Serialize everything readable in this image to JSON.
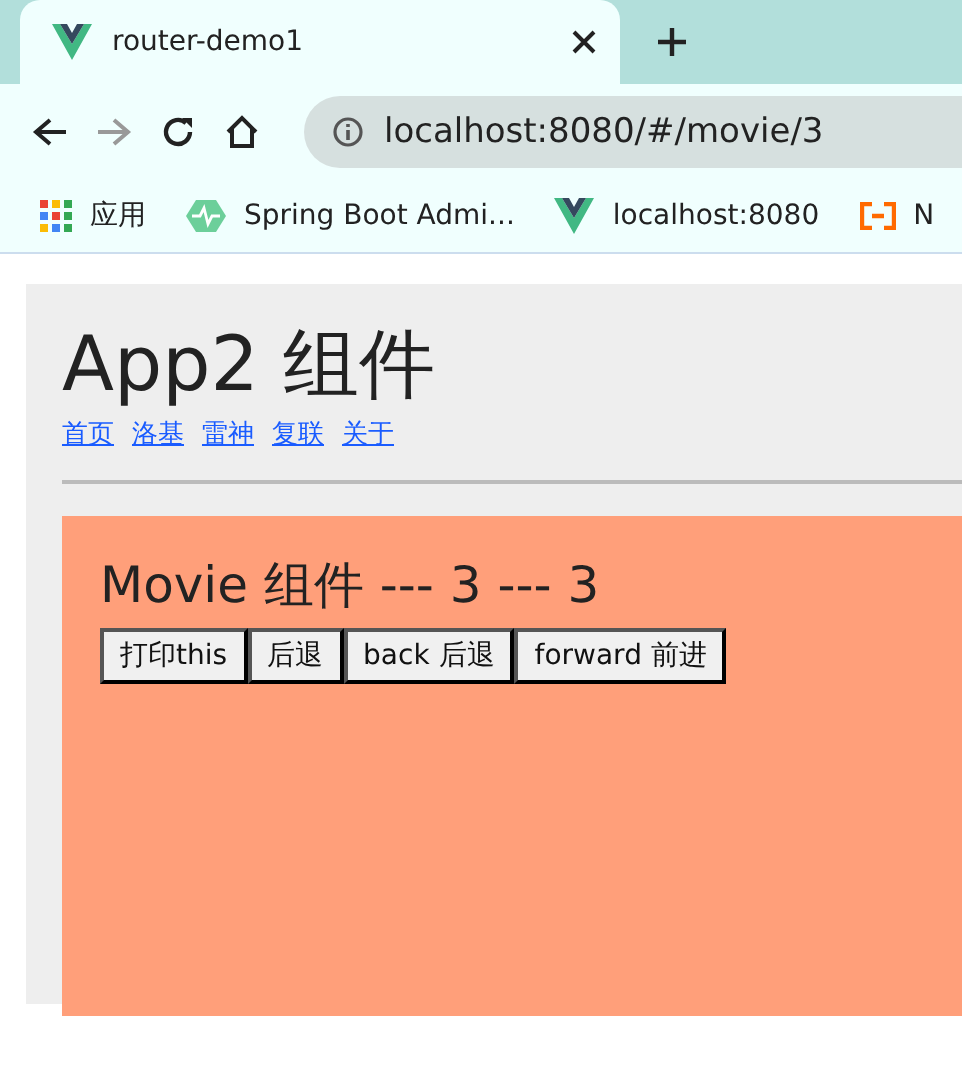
{
  "browser": {
    "tab": {
      "title": "router-demo1",
      "selected": true
    },
    "address": "localhost:8080/#/movie/3",
    "bookmarks": [
      {
        "kind": "apps",
        "label": "应用"
      },
      {
        "kind": "monitor",
        "label": "Spring Boot Admi..."
      },
      {
        "kind": "vue",
        "label": "localhost:8080"
      },
      {
        "kind": "bracket",
        "label": "N"
      }
    ]
  },
  "page": {
    "title": "App2 组件",
    "links": [
      "首页",
      "洛基",
      "雷神",
      "复联",
      "关于"
    ],
    "movie": {
      "heading": "Movie 组件 --- 3 --- 3",
      "buttons": [
        "打印this",
        "后退",
        "back 后退",
        "forward 前进"
      ]
    }
  }
}
